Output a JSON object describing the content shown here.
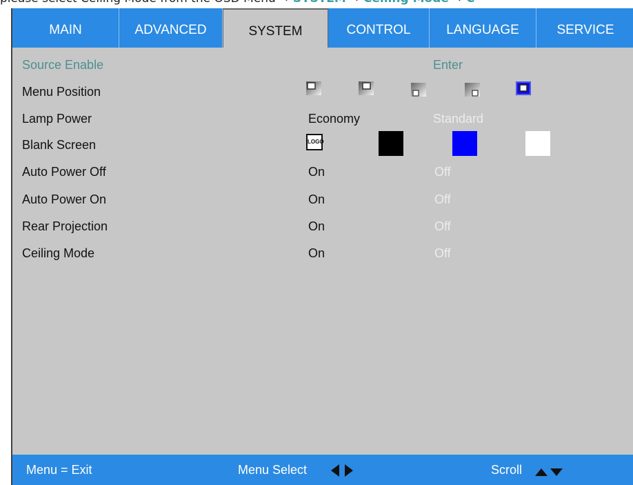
{
  "caption": {
    "prefix": "please select Ceiling Mode from the OSD Menu",
    "sep": " → ",
    "path1": "SYSTEM",
    "path2": "Ceiling Mode",
    "tail": "C"
  },
  "tabs": [
    {
      "label": "MAIN"
    },
    {
      "label": "ADVANCED"
    },
    {
      "label": "SYSTEM",
      "active": true
    },
    {
      "label": "CONTROL"
    },
    {
      "label": "LANGUAGE"
    },
    {
      "label": "SERVICE"
    }
  ],
  "rows": {
    "source_enable": {
      "label": "Source Enable",
      "value": "Enter"
    },
    "menu_position": {
      "label": "Menu Position",
      "selected_index": 4
    },
    "lamp_power": {
      "label": "Lamp Power",
      "option1": "Economy",
      "option2": "Standard"
    },
    "blank_screen": {
      "label": "Blank Screen",
      "logo_text": "LOGO",
      "colors": [
        "#000000",
        "#0000ff",
        "#ffffff"
      ]
    },
    "auto_power_off": {
      "label": "Auto Power Off",
      "on": "On",
      "off": "Off"
    },
    "auto_power_on": {
      "label": "Auto Power On",
      "on": "On",
      "off": "Off"
    },
    "rear_projection": {
      "label": "Rear Projection",
      "on": "On",
      "off": "Off"
    },
    "ceiling_mode": {
      "label": "Ceiling Mode",
      "on": "On",
      "off": "Off"
    }
  },
  "footer": {
    "exit": "Menu = Exit",
    "select": "Menu Select",
    "scroll": "Scroll"
  },
  "colors": {
    "accent_blue": "#2b8ae3",
    "panel_gray": "#c7c7c7",
    "dim_text": "#ececec",
    "teal_text": "#4f8f8f"
  },
  "icons": [
    "menu-position-top-left-icon",
    "menu-position-top-center-icon",
    "menu-position-bottom-left-icon",
    "menu-position-bottom-right-icon",
    "menu-position-center-icon",
    "left-right-arrows-icon",
    "up-down-arrows-icon"
  ]
}
